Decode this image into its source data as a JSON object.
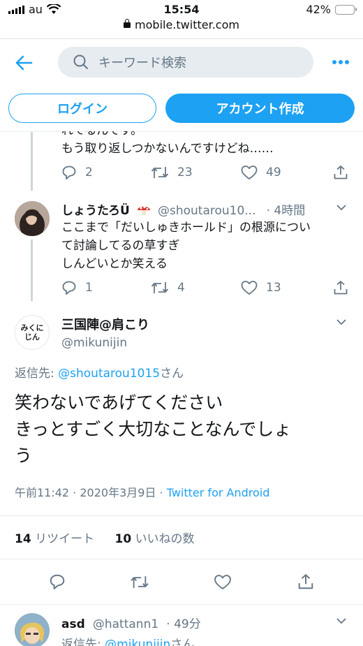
{
  "status": {
    "carrier": "au",
    "time": "15:54",
    "battery": "42%",
    "battery_level": 0.42
  },
  "url": "mobile.twitter.com",
  "search": {
    "placeholder": "キーワード検索"
  },
  "auth": {
    "login": "ログイン",
    "signup": "アカウント作成"
  },
  "tweet1": {
    "text_cut": "れてるんです。",
    "text_line": "もう取り返しつかないんですけどね……",
    "replies": "2",
    "retweets": "23",
    "likes": "49"
  },
  "tweet2": {
    "name": "しょうたろÜ",
    "handle": "@shoutarou10...",
    "time": "· 4時間",
    "lines": [
      "ここまで「だいしゅきホールド」の根源につい",
      "て討論してるの草すぎ",
      "しんどいとか笑える"
    ],
    "replies": "1",
    "retweets": "4",
    "likes": "13"
  },
  "main": {
    "avatar_text": [
      "みくに",
      "じん"
    ],
    "name": "三国陣@肩こり",
    "handle": "@mikunijin",
    "reply_prefix": "返信先: ",
    "reply_to": "@shoutarou1015",
    "reply_suffix": "さん",
    "lines": [
      "笑わないであげてください",
      "きっとすごく大切なことなんでしょ",
      "う"
    ],
    "timestamp": "午前11:42 · 2020年3月9日 · ",
    "source": "Twitter for Android",
    "retweet_count": "14",
    "retweet_label": "リツイート",
    "like_count": "10",
    "like_label": "いいねの数"
  },
  "tweet3": {
    "name": "asd",
    "handle": "@hattann1",
    "time": "· 49分",
    "reply_prefix": "返信先: ",
    "reply_to": "@mikunijin",
    "reply_suffix": "さん"
  }
}
